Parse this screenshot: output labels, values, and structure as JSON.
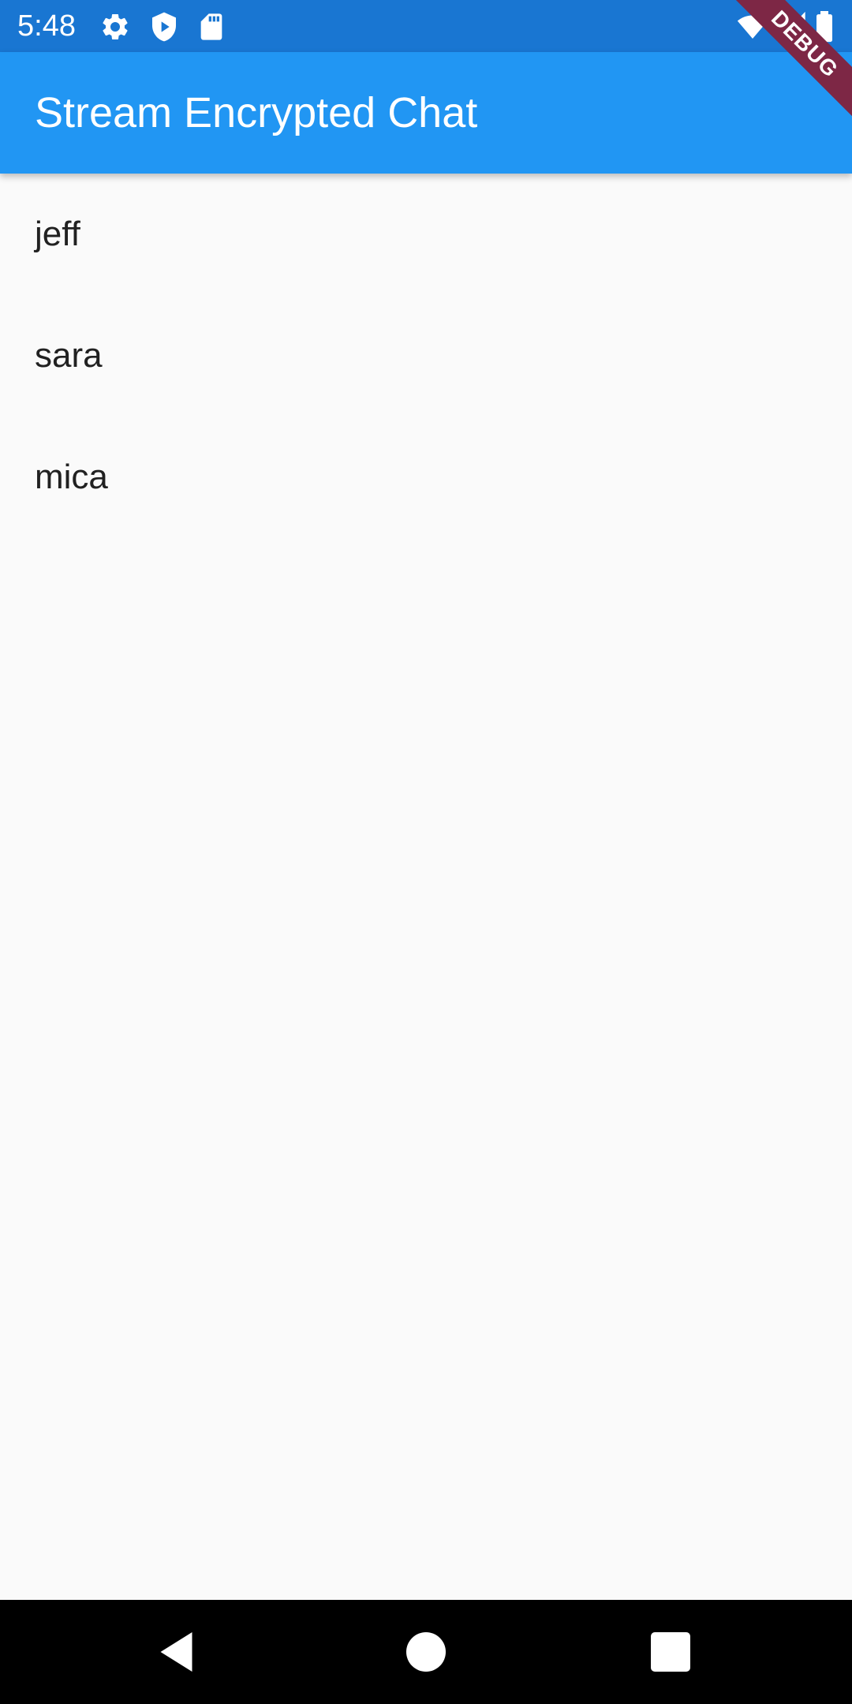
{
  "status_bar": {
    "time": "5:48",
    "icons": [
      "settings-icon",
      "shield-play-icon",
      "sd-card-icon",
      "wifi-icon",
      "signal-icon",
      "battery-icon"
    ]
  },
  "debug_banner": {
    "label": "DEBUG"
  },
  "app_bar": {
    "title": "Stream Encrypted Chat",
    "color": "#2196f3"
  },
  "users": [
    {
      "name": "jeff"
    },
    {
      "name": "sara"
    },
    {
      "name": "mica"
    }
  ],
  "nav_bar": {
    "buttons": [
      "back-icon",
      "home-icon",
      "recents-icon"
    ]
  }
}
